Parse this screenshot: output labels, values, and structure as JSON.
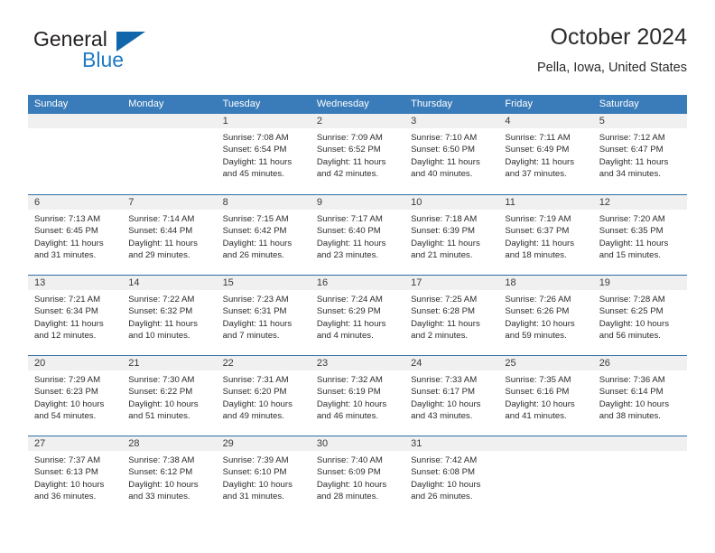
{
  "brand": {
    "name_part1": "General",
    "name_part2": "Blue",
    "logo_icon": "triangle-logo-icon"
  },
  "header": {
    "title": "October 2024",
    "location": "Pella, Iowa, United States"
  },
  "colors": {
    "header_blue": "#3a7cb9",
    "week_divider_blue": "#2f6ea5",
    "date_strip_grey": "#f0f0f0",
    "brand_blue": "#1f7ac4",
    "logo_blue": "#1166ab"
  },
  "weekdays": [
    "Sunday",
    "Monday",
    "Tuesday",
    "Wednesday",
    "Thursday",
    "Friday",
    "Saturday"
  ],
  "weeks": [
    [
      {
        "day": "",
        "empty": true,
        "lines": []
      },
      {
        "day": "",
        "empty": true,
        "lines": []
      },
      {
        "day": "1",
        "empty": false,
        "lines": [
          "Sunrise: 7:08 AM",
          "Sunset: 6:54 PM",
          "Daylight: 11 hours and 45 minutes."
        ]
      },
      {
        "day": "2",
        "empty": false,
        "lines": [
          "Sunrise: 7:09 AM",
          "Sunset: 6:52 PM",
          "Daylight: 11 hours and 42 minutes."
        ]
      },
      {
        "day": "3",
        "empty": false,
        "lines": [
          "Sunrise: 7:10 AM",
          "Sunset: 6:50 PM",
          "Daylight: 11 hours and 40 minutes."
        ]
      },
      {
        "day": "4",
        "empty": false,
        "lines": [
          "Sunrise: 7:11 AM",
          "Sunset: 6:49 PM",
          "Daylight: 11 hours and 37 minutes."
        ]
      },
      {
        "day": "5",
        "empty": false,
        "lines": [
          "Sunrise: 7:12 AM",
          "Sunset: 6:47 PM",
          "Daylight: 11 hours and 34 minutes."
        ]
      }
    ],
    [
      {
        "day": "6",
        "empty": false,
        "lines": [
          "Sunrise: 7:13 AM",
          "Sunset: 6:45 PM",
          "Daylight: 11 hours and 31 minutes."
        ]
      },
      {
        "day": "7",
        "empty": false,
        "lines": [
          "Sunrise: 7:14 AM",
          "Sunset: 6:44 PM",
          "Daylight: 11 hours and 29 minutes."
        ]
      },
      {
        "day": "8",
        "empty": false,
        "lines": [
          "Sunrise: 7:15 AM",
          "Sunset: 6:42 PM",
          "Daylight: 11 hours and 26 minutes."
        ]
      },
      {
        "day": "9",
        "empty": false,
        "lines": [
          "Sunrise: 7:17 AM",
          "Sunset: 6:40 PM",
          "Daylight: 11 hours and 23 minutes."
        ]
      },
      {
        "day": "10",
        "empty": false,
        "lines": [
          "Sunrise: 7:18 AM",
          "Sunset: 6:39 PM",
          "Daylight: 11 hours and 21 minutes."
        ]
      },
      {
        "day": "11",
        "empty": false,
        "lines": [
          "Sunrise: 7:19 AM",
          "Sunset: 6:37 PM",
          "Daylight: 11 hours and 18 minutes."
        ]
      },
      {
        "day": "12",
        "empty": false,
        "lines": [
          "Sunrise: 7:20 AM",
          "Sunset: 6:35 PM",
          "Daylight: 11 hours and 15 minutes."
        ]
      }
    ],
    [
      {
        "day": "13",
        "empty": false,
        "lines": [
          "Sunrise: 7:21 AM",
          "Sunset: 6:34 PM",
          "Daylight: 11 hours and 12 minutes."
        ]
      },
      {
        "day": "14",
        "empty": false,
        "lines": [
          "Sunrise: 7:22 AM",
          "Sunset: 6:32 PM",
          "Daylight: 11 hours and 10 minutes."
        ]
      },
      {
        "day": "15",
        "empty": false,
        "lines": [
          "Sunrise: 7:23 AM",
          "Sunset: 6:31 PM",
          "Daylight: 11 hours and 7 minutes."
        ]
      },
      {
        "day": "16",
        "empty": false,
        "lines": [
          "Sunrise: 7:24 AM",
          "Sunset: 6:29 PM",
          "Daylight: 11 hours and 4 minutes."
        ]
      },
      {
        "day": "17",
        "empty": false,
        "lines": [
          "Sunrise: 7:25 AM",
          "Sunset: 6:28 PM",
          "Daylight: 11 hours and 2 minutes."
        ]
      },
      {
        "day": "18",
        "empty": false,
        "lines": [
          "Sunrise: 7:26 AM",
          "Sunset: 6:26 PM",
          "Daylight: 10 hours and 59 minutes."
        ]
      },
      {
        "day": "19",
        "empty": false,
        "lines": [
          "Sunrise: 7:28 AM",
          "Sunset: 6:25 PM",
          "Daylight: 10 hours and 56 minutes."
        ]
      }
    ],
    [
      {
        "day": "20",
        "empty": false,
        "lines": [
          "Sunrise: 7:29 AM",
          "Sunset: 6:23 PM",
          "Daylight: 10 hours and 54 minutes."
        ]
      },
      {
        "day": "21",
        "empty": false,
        "lines": [
          "Sunrise: 7:30 AM",
          "Sunset: 6:22 PM",
          "Daylight: 10 hours and 51 minutes."
        ]
      },
      {
        "day": "22",
        "empty": false,
        "lines": [
          "Sunrise: 7:31 AM",
          "Sunset: 6:20 PM",
          "Daylight: 10 hours and 49 minutes."
        ]
      },
      {
        "day": "23",
        "empty": false,
        "lines": [
          "Sunrise: 7:32 AM",
          "Sunset: 6:19 PM",
          "Daylight: 10 hours and 46 minutes."
        ]
      },
      {
        "day": "24",
        "empty": false,
        "lines": [
          "Sunrise: 7:33 AM",
          "Sunset: 6:17 PM",
          "Daylight: 10 hours and 43 minutes."
        ]
      },
      {
        "day": "25",
        "empty": false,
        "lines": [
          "Sunrise: 7:35 AM",
          "Sunset: 6:16 PM",
          "Daylight: 10 hours and 41 minutes."
        ]
      },
      {
        "day": "26",
        "empty": false,
        "lines": [
          "Sunrise: 7:36 AM",
          "Sunset: 6:14 PM",
          "Daylight: 10 hours and 38 minutes."
        ]
      }
    ],
    [
      {
        "day": "27",
        "empty": false,
        "lines": [
          "Sunrise: 7:37 AM",
          "Sunset: 6:13 PM",
          "Daylight: 10 hours and 36 minutes."
        ]
      },
      {
        "day": "28",
        "empty": false,
        "lines": [
          "Sunrise: 7:38 AM",
          "Sunset: 6:12 PM",
          "Daylight: 10 hours and 33 minutes."
        ]
      },
      {
        "day": "29",
        "empty": false,
        "lines": [
          "Sunrise: 7:39 AM",
          "Sunset: 6:10 PM",
          "Daylight: 10 hours and 31 minutes."
        ]
      },
      {
        "day": "30",
        "empty": false,
        "lines": [
          "Sunrise: 7:40 AM",
          "Sunset: 6:09 PM",
          "Daylight: 10 hours and 28 minutes."
        ]
      },
      {
        "day": "31",
        "empty": false,
        "lines": [
          "Sunrise: 7:42 AM",
          "Sunset: 6:08 PM",
          "Daylight: 10 hours and 26 minutes."
        ]
      },
      {
        "day": "",
        "empty": true,
        "lines": []
      },
      {
        "day": "",
        "empty": true,
        "lines": []
      }
    ]
  ]
}
